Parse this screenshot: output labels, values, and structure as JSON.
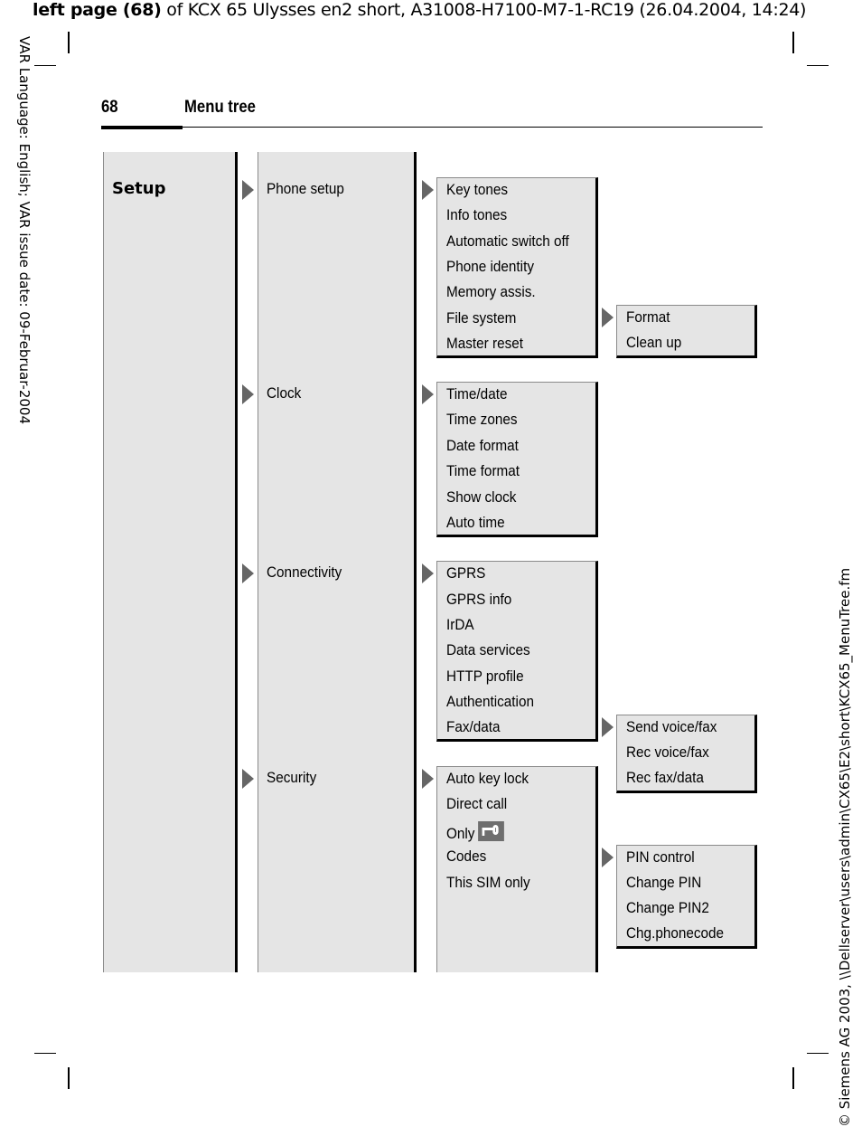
{
  "print_header": {
    "bold": "left page (68)",
    "rest": " of KCX 65 Ulysses en2 short, A31008-H7100-M7-1-RC19 (26.04.2004, 14:24)"
  },
  "side_left": "VAR Language: English; VAR issue date: 09-Februar-2004",
  "side_right": "© Siemens AG 2003, \\\\Dellserver\\users\\admin\\CX65\\E2\\short\\KCX65_MenuTree.fm",
  "page": {
    "number": "68",
    "title": "Menu tree"
  },
  "menu": {
    "root": "Setup",
    "sections": [
      {
        "label": "Phone setup",
        "items": [
          "Key tones",
          "Info tones",
          "Automatic switch off",
          "Phone identity",
          "Memory assis.",
          "File system",
          "Master reset"
        ],
        "submenus": [
          {
            "parent": "File system",
            "items": [
              "Format",
              "Clean up"
            ]
          }
        ]
      },
      {
        "label": "Clock",
        "items": [
          "Time/date",
          "Time zones",
          "Date format",
          "Time format",
          "Show clock",
          "Auto time"
        ]
      },
      {
        "label": "Connectivity",
        "items": [
          "GPRS",
          "GPRS info",
          "IrDA",
          "Data services",
          "HTTP profile",
          "Authentication",
          "Fax/data"
        ],
        "submenus": [
          {
            "parent": "Fax/data",
            "items": [
              "Send voice/fax",
              "Rec voice/fax",
              "Rec fax/data"
            ]
          }
        ]
      },
      {
        "label": "Security",
        "items": [
          "Auto key lock",
          "Direct call",
          "Only",
          "Codes",
          "This SIM only"
        ],
        "only_icon": "key-lock-icon",
        "submenus": [
          {
            "parent": "Codes",
            "items": [
              "PIN control",
              "Change PIN",
              "Change PIN2",
              "Chg.phonecode"
            ]
          }
        ]
      }
    ]
  },
  "colors": {
    "panel": "#e5e5e5",
    "arrow": "#666666",
    "border": "#000000"
  }
}
